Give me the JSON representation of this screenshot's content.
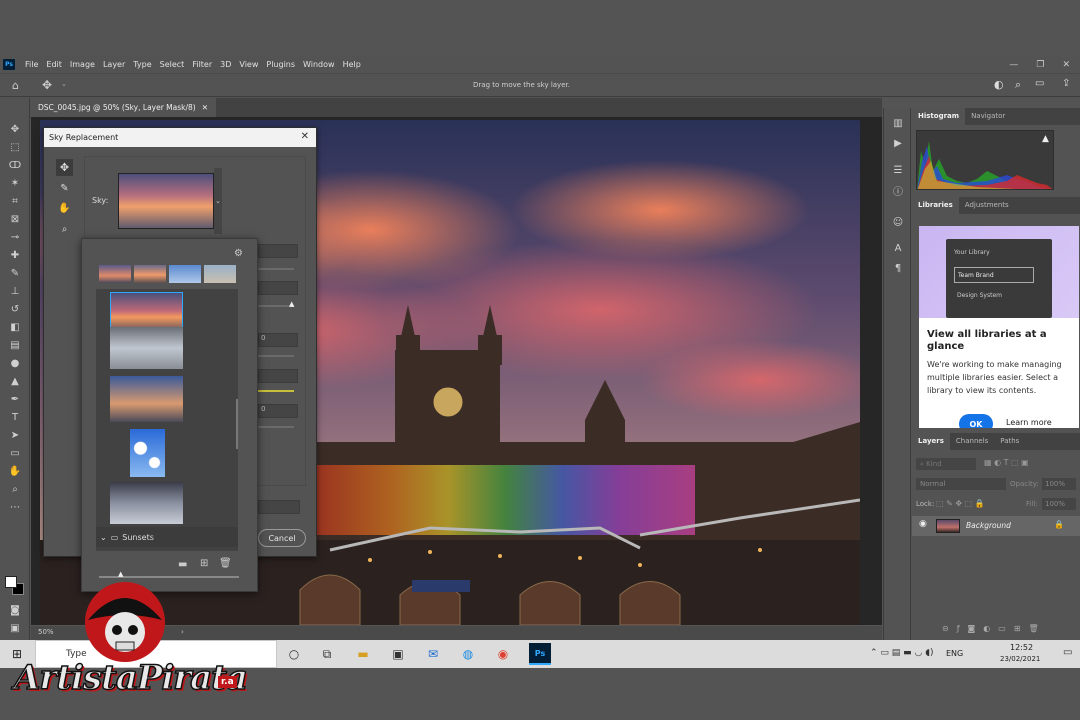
{
  "app": {
    "logo": "Ps",
    "menu": [
      "File",
      "Edit",
      "Image",
      "Layer",
      "Type",
      "Select",
      "Filter",
      "3D",
      "View",
      "Plugins",
      "Window",
      "Help"
    ],
    "hint": "Drag to move the sky layer."
  },
  "document": {
    "tab_title": "DSC_0045.jpg @ 50% (Sky, Layer Mask/8)",
    "zoom": "50%"
  },
  "dialog": {
    "title": "Sky Replacement",
    "sky_label": "Sky:",
    "cancel_label": "Cancel",
    "fields": [
      "0",
      "",
      "0",
      "0"
    ],
    "folder_name": "Sunsets"
  },
  "panels": {
    "top_tabs": [
      "Histogram",
      "Navigator"
    ],
    "mid_tabs": [
      "Libraries",
      "Adjustments"
    ],
    "layers_tabs": [
      "Layers",
      "Channels",
      "Paths"
    ],
    "library_promo": {
      "items": [
        "Your Library",
        "Team Brand",
        "Design System"
      ],
      "heading": "View all libraries at a glance",
      "body": "We're working to make managing multiple libraries easier. Select a library to view its contents.",
      "ok_label": "OK",
      "learn_more_label": "Learn more"
    },
    "layers": {
      "filter_kind": "Kind",
      "blend_mode": "Normal",
      "opacity_label": "Opacity:",
      "opacity_value": "100%",
      "lock_label": "Lock:",
      "fill_label": "Fill:",
      "fill_value": "100%",
      "layer_name": "Background"
    }
  },
  "taskbar": {
    "search_placeholder": "Type",
    "language": "ENG",
    "time": "12:52",
    "date": "23/02/2021"
  },
  "watermark": {
    "text": "ArtistaPirata",
    "suffix": "r.a"
  },
  "colors": {
    "accent_blue": "#1473e6",
    "ps_blue": "#31a8ff",
    "panel_bg": "#535353"
  }
}
